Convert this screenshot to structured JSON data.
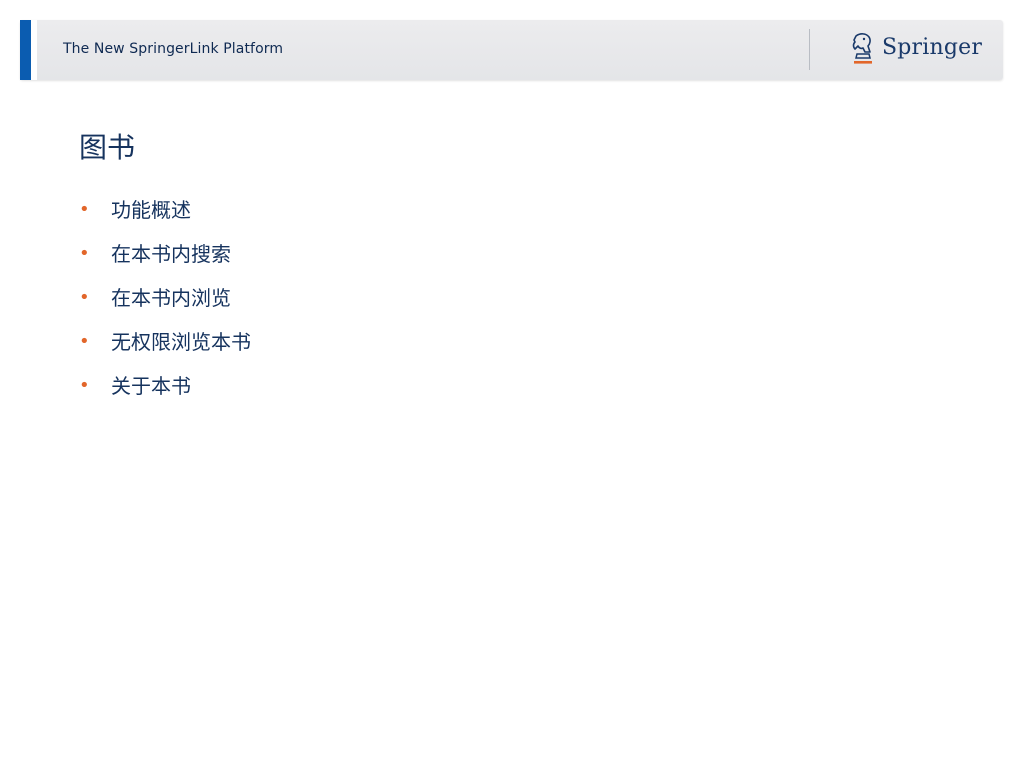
{
  "header": {
    "title": "The New SpringerLink Platform",
    "logo_text": "Springer",
    "logo_icon": "chess-knight-icon",
    "accent_color": "#0b5cb0"
  },
  "slide": {
    "title": "图书",
    "bullet_color": "#e2662a",
    "bullets": [
      {
        "label": "功能概述"
      },
      {
        "label": "在本书内搜索"
      },
      {
        "label": "在本书内浏览"
      },
      {
        "label": "无权限浏览本书"
      },
      {
        "label": "关于本书"
      }
    ]
  }
}
